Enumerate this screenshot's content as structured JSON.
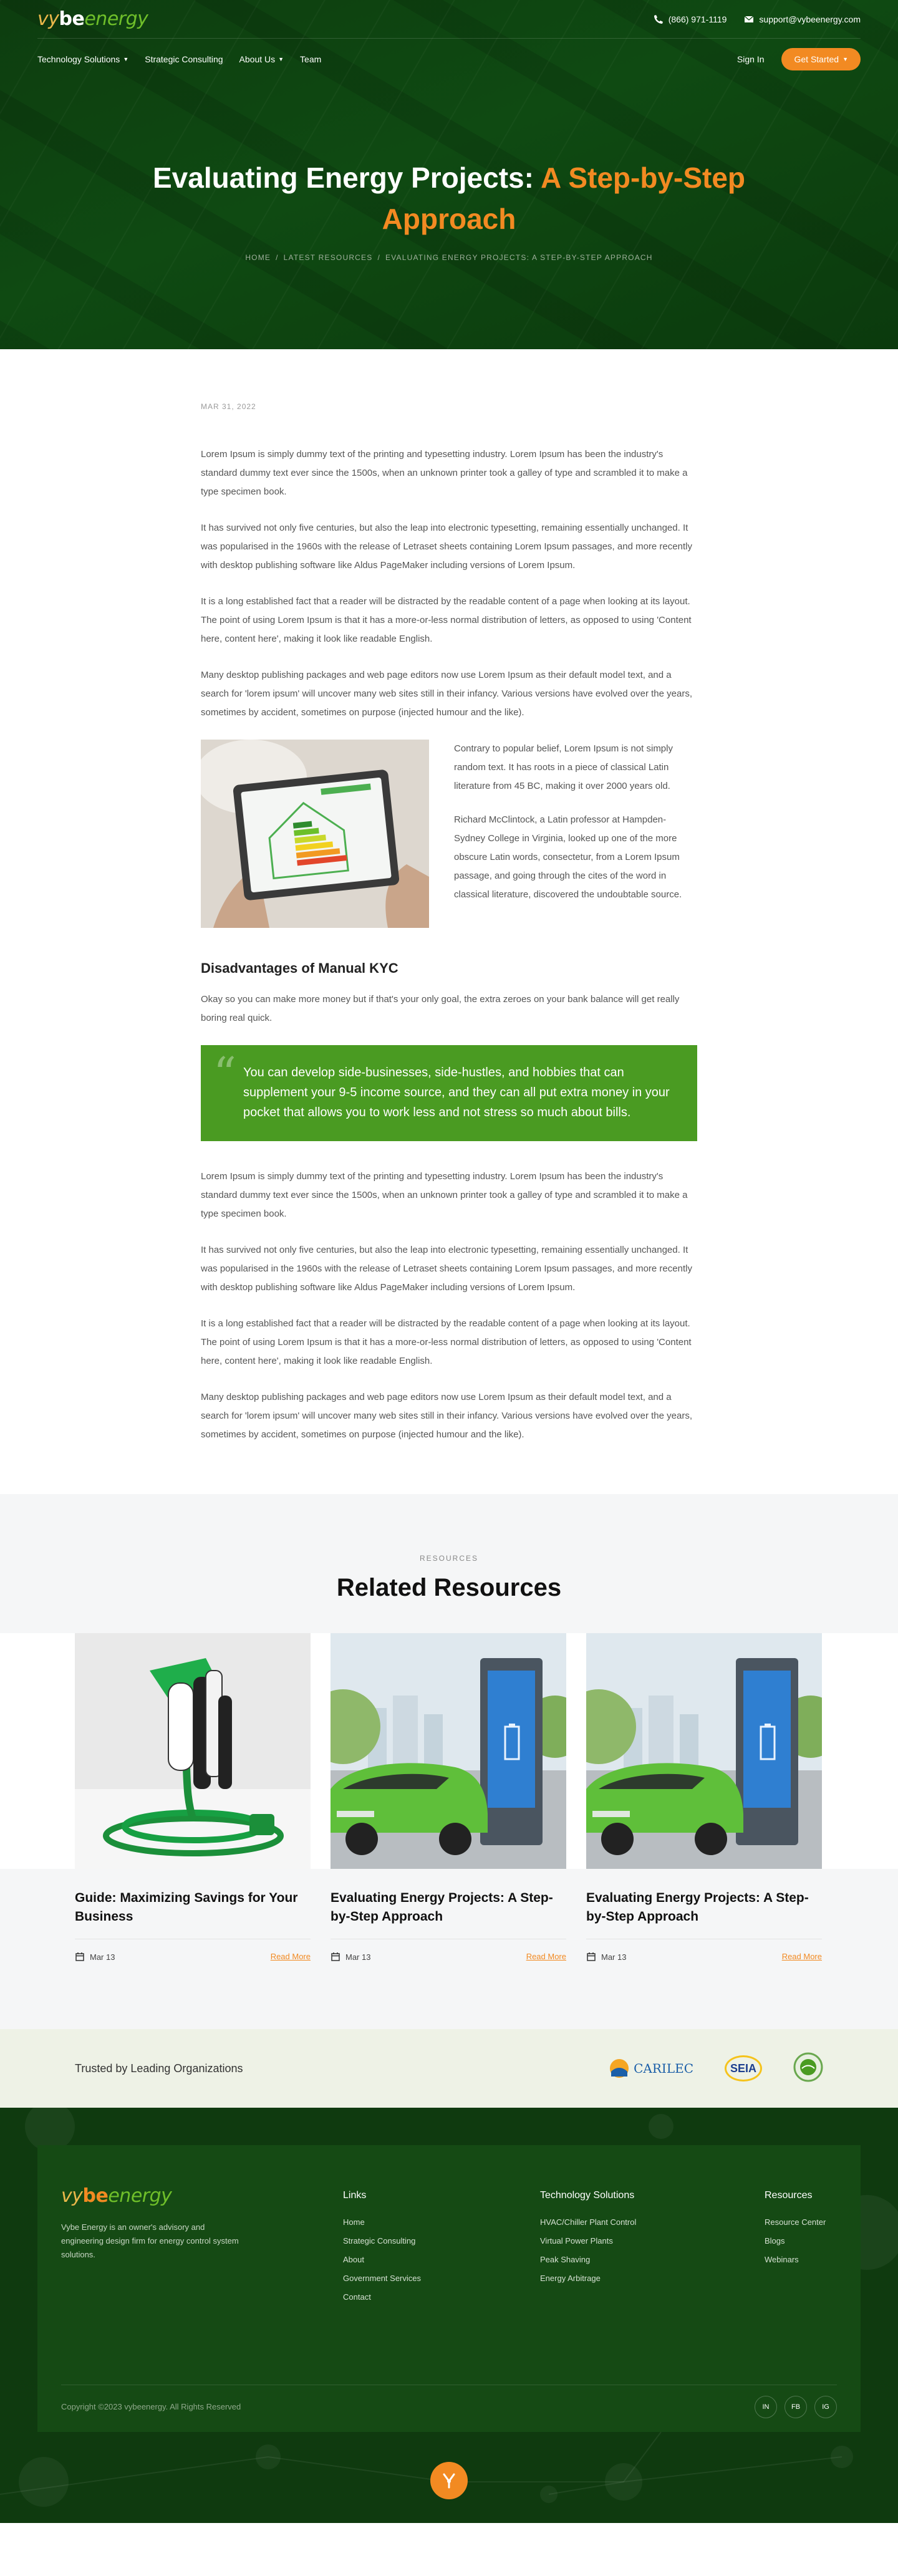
{
  "colors": {
    "accent": "#f28a22",
    "brand_green": "#4a9b22",
    "dark_green": "#0f3a0f"
  },
  "brand": {
    "logo_part1": "vy",
    "logo_part2": "be",
    "logo_part3": "energy"
  },
  "topbar": {
    "phone": "(866) 971-1119",
    "email": "support@vybeenergy.com"
  },
  "nav": {
    "items": [
      "Technology Solutions",
      "Strategic Consulting",
      "About Us",
      "Team"
    ],
    "sign_in": "Sign In",
    "cta": "Get Started"
  },
  "hero": {
    "title_main": "Evaluating Energy Projects: ",
    "title_accent": "A Step-by-Step Approach",
    "breadcrumb": [
      "HOME",
      "LATEST RESOURCES",
      "EVALUATING ENERGY PROJECTS: A STEP-BY-STEP APPROACH"
    ],
    "breadcrumb_sep": "/"
  },
  "article": {
    "date": "MAR 31, 2022",
    "intro": [
      "Lorem Ipsum is simply dummy text of the printing and typesetting industry. Lorem Ipsum has been the industry's standard dummy text ever since the 1500s, when an unknown printer took a galley of type and scrambled it to make a type specimen book.",
      "It has survived not only five centuries, but also the leap into electronic typesetting, remaining essentially unchanged. It was popularised in the 1960s with the release of Letraset sheets containing Lorem Ipsum passages, and more recently with desktop publishing software like Aldus PageMaker including versions of Lorem Ipsum.",
      "It is a long established fact that a reader will be distracted by the readable content of a page when looking at its layout. The point of using Lorem Ipsum is that it has a more-or-less normal distribution of letters, as opposed to using 'Content here, content here', making it look like readable English.",
      "Many desktop publishing packages and web page editors now use Lorem Ipsum as their default model text, and a search for 'lorem ipsum' will uncover many web sites still in their infancy. Various versions have evolved over the years, sometimes by accident, sometimes on purpose (injected humour and the like)."
    ],
    "side": [
      "Contrary to popular belief, Lorem Ipsum is not simply random text. It has roots in a piece of classical Latin literature from 45 BC, making it over 2000 years old.",
      "Richard McClintock, a Latin professor at Hampden-Sydney College in Virginia, looked up one of the more obscure Latin words, consectetur, from a Lorem Ipsum passage, and going through the cites of the word in classical literature, discovered the undoubtable source."
    ],
    "subheading": "Disadvantages of Manual KYC",
    "sub_text": "Okay so you can make more money but if that's your only goal, the extra zeroes on your bank balance will get really boring real quick.",
    "quote": "You can develop side-businesses, side-hustles, and hobbies that can supplement your 9-5 income source, and they can all put extra money in your pocket that allows you to work less and not stress so much about bills.",
    "outro": [
      "Lorem Ipsum is simply dummy text of the printing and typesetting industry. Lorem Ipsum has been the industry's standard dummy text ever since the 1500s, when an unknown printer took a galley of type and scrambled it to make a type specimen book.",
      "It has survived not only five centuries, but also the leap into electronic typesetting, remaining essentially unchanged. It was popularised in the 1960s with the release of Letraset sheets containing Lorem Ipsum passages, and more recently with desktop publishing software like Aldus PageMaker including versions of Lorem Ipsum.",
      "It is a long established fact that a reader will be distracted by the readable content of a page when looking at its layout. The point of using Lorem Ipsum is that it has a more-or-less normal distribution of letters, as opposed to using 'Content here, content here', making it look like readable English.",
      "Many desktop publishing packages and web page editors now use Lorem Ipsum as their default model text, and a search for 'lorem ipsum' will uncover many web sites still in their infancy. Various versions have evolved over the years, sometimes by accident, sometimes on purpose (injected humour and the like)."
    ]
  },
  "related": {
    "eyebrow": "RESOURCES",
    "title": "Related Resources",
    "cards": [
      {
        "title": "Guide: Maximizing Savings for Your Business",
        "date": "Mar 13",
        "link": "Read More"
      },
      {
        "title": "Evaluating Energy Projects: A Step-by-Step Approach",
        "date": "Mar 13",
        "link": "Read More"
      },
      {
        "title": "Evaluating Energy Projects: A Step-by-Step Approach",
        "date": "Mar 13",
        "link": "Read More"
      }
    ]
  },
  "trust": {
    "label": "Trusted by Leading Organizations",
    "logo1": "CARILEC",
    "logo2": "SEIA"
  },
  "footer": {
    "description": "Vybe Energy is an owner's advisory and engineering design firm for energy control system solutions.",
    "links_title": "Links",
    "links": [
      "Home",
      "Strategic Consulting",
      "About",
      "Government Services",
      "Contact"
    ],
    "tech_title": "Technology Solutions",
    "tech": [
      "HVAC/Chiller Plant Control",
      "Virtual Power Plants",
      "Peak Shaving",
      "Energy Arbitrage"
    ],
    "res_title": "Resources",
    "resources": [
      "Resource Center",
      "Blogs",
      "Webinars"
    ],
    "copyright": "Copyright ©2023 vybeenergy. All Rights Reserved",
    "socials": [
      "IN",
      "FB",
      "IG"
    ]
  }
}
